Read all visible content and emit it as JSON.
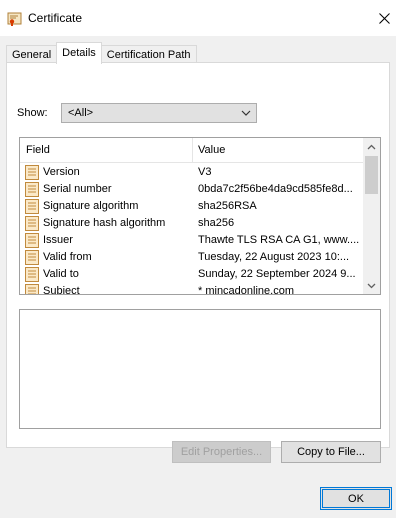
{
  "window": {
    "title": "Certificate"
  },
  "tabs": [
    {
      "label": "General"
    },
    {
      "label": "Details"
    },
    {
      "label": "Certification Path"
    }
  ],
  "show": {
    "label": "Show:",
    "selected": "<All>"
  },
  "list": {
    "headers": {
      "field": "Field",
      "value": "Value"
    },
    "rows": [
      {
        "field": "Version",
        "value": "V3"
      },
      {
        "field": "Serial number",
        "value": "0bda7c2f56be4da9cd585fe8d..."
      },
      {
        "field": "Signature algorithm",
        "value": "sha256RSA"
      },
      {
        "field": "Signature hash algorithm",
        "value": "sha256"
      },
      {
        "field": "Issuer",
        "value": "Thawte TLS RSA CA G1, www...."
      },
      {
        "field": "Valid from",
        "value": "Tuesday, 22 August 2023 10:..."
      },
      {
        "field": "Valid to",
        "value": "Sunday, 22 September 2024 9..."
      },
      {
        "field": "Subject",
        "value": "* mincadonline.com"
      }
    ]
  },
  "buttons": {
    "edit_properties": "Edit Properties...",
    "copy_to_file": "Copy to File...",
    "ok": "OK"
  },
  "icons": {
    "title": "certificate-icon",
    "close": "close-icon",
    "row": "certificate-field-icon",
    "dropdown": "chevron-down-icon",
    "scroll_up": "scroll-up-icon",
    "scroll_down": "scroll-down-icon"
  },
  "colors": {
    "accent": "#0078d7",
    "panel": "#f0f0f0",
    "button": "#e1e1e1"
  }
}
